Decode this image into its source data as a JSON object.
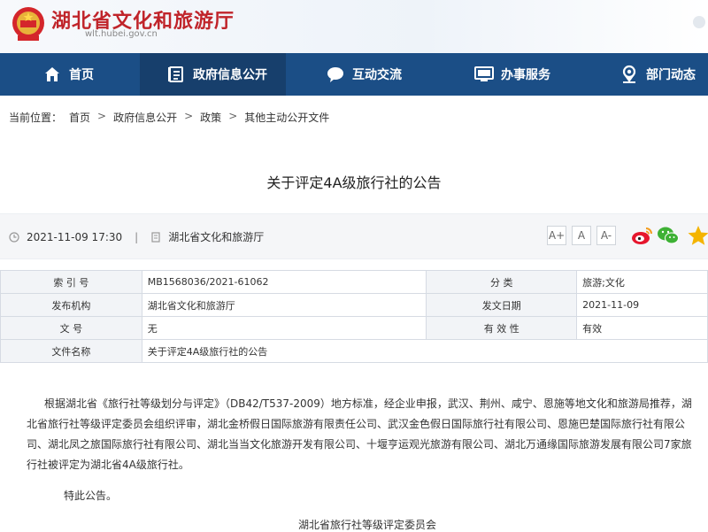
{
  "header": {
    "site_title": "湖北省文化和旅游厅",
    "site_domain": "wlt.hubei.gov.cn"
  },
  "nav": {
    "items": [
      {
        "label": "首页",
        "icon": "home-icon"
      },
      {
        "label": "政府信息公开",
        "icon": "document-list-icon",
        "active": true
      },
      {
        "label": "互动交流",
        "icon": "chat-bubble-icon"
      },
      {
        "label": "办事服务",
        "icon": "monitor-icon"
      },
      {
        "label": "部门动态",
        "icon": "location-pin-icon"
      }
    ]
  },
  "breadcrumb": {
    "prefix": "当前位置：",
    "items": [
      "首页",
      "政府信息公开",
      "政策",
      "其他主动公开文件"
    ],
    "separator": ">"
  },
  "article": {
    "title": "关于评定4A级旅行社的公告",
    "datetime": "2021-11-09 17:30",
    "separator": "|",
    "source": "湖北省文化和旅游厅",
    "font_buttons": [
      "A+",
      "A",
      "A-"
    ]
  },
  "info_table": {
    "rows": [
      {
        "k1": "索  引  号",
        "v1": "MB1568036/2021-61062",
        "k2": "分      类",
        "v2": "旅游;文化"
      },
      {
        "k1": "发布机构",
        "v1": "湖北省文化和旅游厅",
        "k2": "发文日期",
        "v2": "2021-11-09"
      },
      {
        "k1": "文      号",
        "v1": "无",
        "k2": "有 效 性",
        "v2": "有效"
      },
      {
        "k1": "文件名称",
        "v1": "关于评定4A级旅行社的公告"
      }
    ]
  },
  "body": {
    "line1": "根据湖北省《旅行社等级划分与评定》（DB42/T537-2009）地方标准，经企业申报，武汉、荆州、咸宁、恩施等地文化和旅游局推荐，湖",
    "line2": "北省旅行社等级评定委员会组织评审，湖北金桥假日国际旅游有限责任公司、武汉金色假日国际旅行社有限公司、恩施巴楚国际旅行社有限公",
    "line3": "司、湖北凤之旅国际旅行社有限公司、湖北当当文化旅游开发有限公司、十堰亨运观光旅游有限公司、湖北万通缘国际旅游发展有限公司7家旅",
    "line4": "行社被评定为湖北省4A级旅行社。",
    "closing": "特此公告。",
    "signature": "湖北省旅行社等级评定委员会"
  },
  "colors": {
    "nav_bg": "#1b4e86",
    "nav_active_bg": "#173f6c",
    "title_red": "#c0242a"
  }
}
